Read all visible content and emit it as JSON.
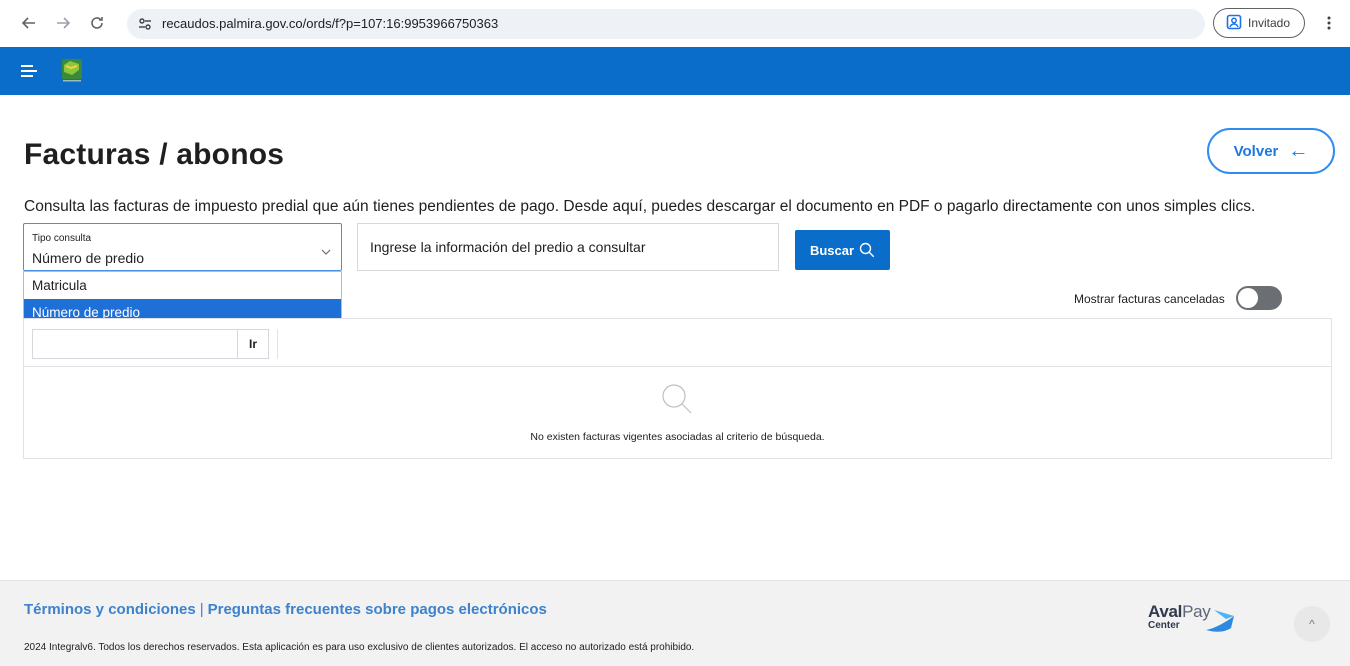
{
  "browser": {
    "url": "recaudos.palmira.gov.co/ords/f?p=107:16:9953966750363",
    "profile_label": "Invitado"
  },
  "icons": {
    "back": "arrow-left-icon",
    "forward": "arrow-right-icon",
    "reload": "reload-icon",
    "site_info": "tune-icon",
    "profile": "person-icon",
    "more": "kebab-icon",
    "menu": "hamburger-icon",
    "search": "search-icon",
    "chevron": "chevron-down-icon"
  },
  "header": {
    "accent_color": "#0a6dc9"
  },
  "main": {
    "title": "Facturas / abonos",
    "back_button": "Volver",
    "back_arrow": "←",
    "description": "Consulta las facturas de impuesto predial que aún tienes pendientes de pago. Desde aquí, puedes descargar el documento en PDF o pagarlo directamente con unos simples clics.",
    "query_type": {
      "label": "Tipo consulta",
      "value": "Número de predio",
      "options": [
        "Matricula",
        "Número de predio"
      ]
    },
    "search_input": {
      "placeholder": "Ingrese la información del predio a consultar"
    },
    "search_button": "Buscar",
    "toggle_label": "Mostrar facturas canceladas",
    "go_button": "Ir",
    "empty_message": "No existen facturas vigentes asociadas al criterio de búsqueda."
  },
  "footer": {
    "terms": "Términos y condiciones",
    "separator": "|",
    "faq": "Preguntas frecuentes sobre pagos electrónicos",
    "copyright": "2024 Integralv6. Todos los derechos reservados. Esta aplicación es para uso exclusivo de clientes autorizados. El acceso no autorizado está prohibido.",
    "brand_aval": "Aval",
    "brand_pay": "Pay",
    "brand_sub": "Center",
    "scroll_top": "^"
  }
}
